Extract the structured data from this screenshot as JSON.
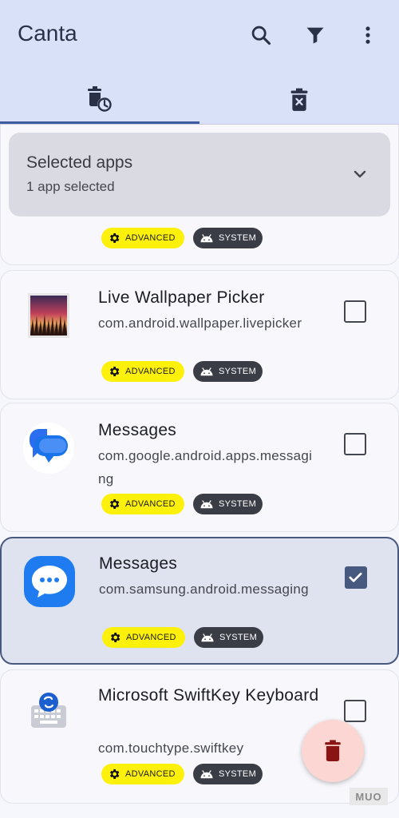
{
  "app": {
    "title": "Canta"
  },
  "toolbar": {
    "search_icon": "search-icon",
    "filter_icon": "filter-icon",
    "menu_icon": "more-vert-icon"
  },
  "tabs": [
    {
      "name": "uninstall-apps",
      "icon": "delete-clock-icon",
      "active": true
    },
    {
      "name": "uninstalled-apps",
      "icon": "delete-x-icon",
      "active": false
    }
  ],
  "selected_panel": {
    "title": "Selected apps",
    "subtitle": "1 app selected"
  },
  "chips": {
    "advanced": "ADVANCED",
    "system": "SYSTEM"
  },
  "apps": [
    {
      "name": "Live Wallpaper Picker",
      "package": "com.android.wallpaper.livepicker",
      "checked": false,
      "icon": "wallpaper-icon"
    },
    {
      "name": "Messages",
      "package": "com.google.android.apps.messaging",
      "checked": false,
      "icon": "google-messages-icon"
    },
    {
      "name": "Messages",
      "package": "com.samsung.android.messaging",
      "checked": true,
      "icon": "samsung-messages-icon"
    },
    {
      "name": "Microsoft SwiftKey Keyboard",
      "package": "com.touchtype.swiftkey",
      "checked": false,
      "icon": "swiftkey-icon"
    }
  ],
  "fab": {
    "icon": "delete-icon"
  },
  "watermark": "MUO",
  "colors": {
    "appbar": "#d9e1f8",
    "accent": "#3e5aa3",
    "advanced_chip": "#fdf00a",
    "system_chip": "#3a3d45",
    "fab": "#fbd6d2",
    "checkbox_checked": "#48597f"
  }
}
